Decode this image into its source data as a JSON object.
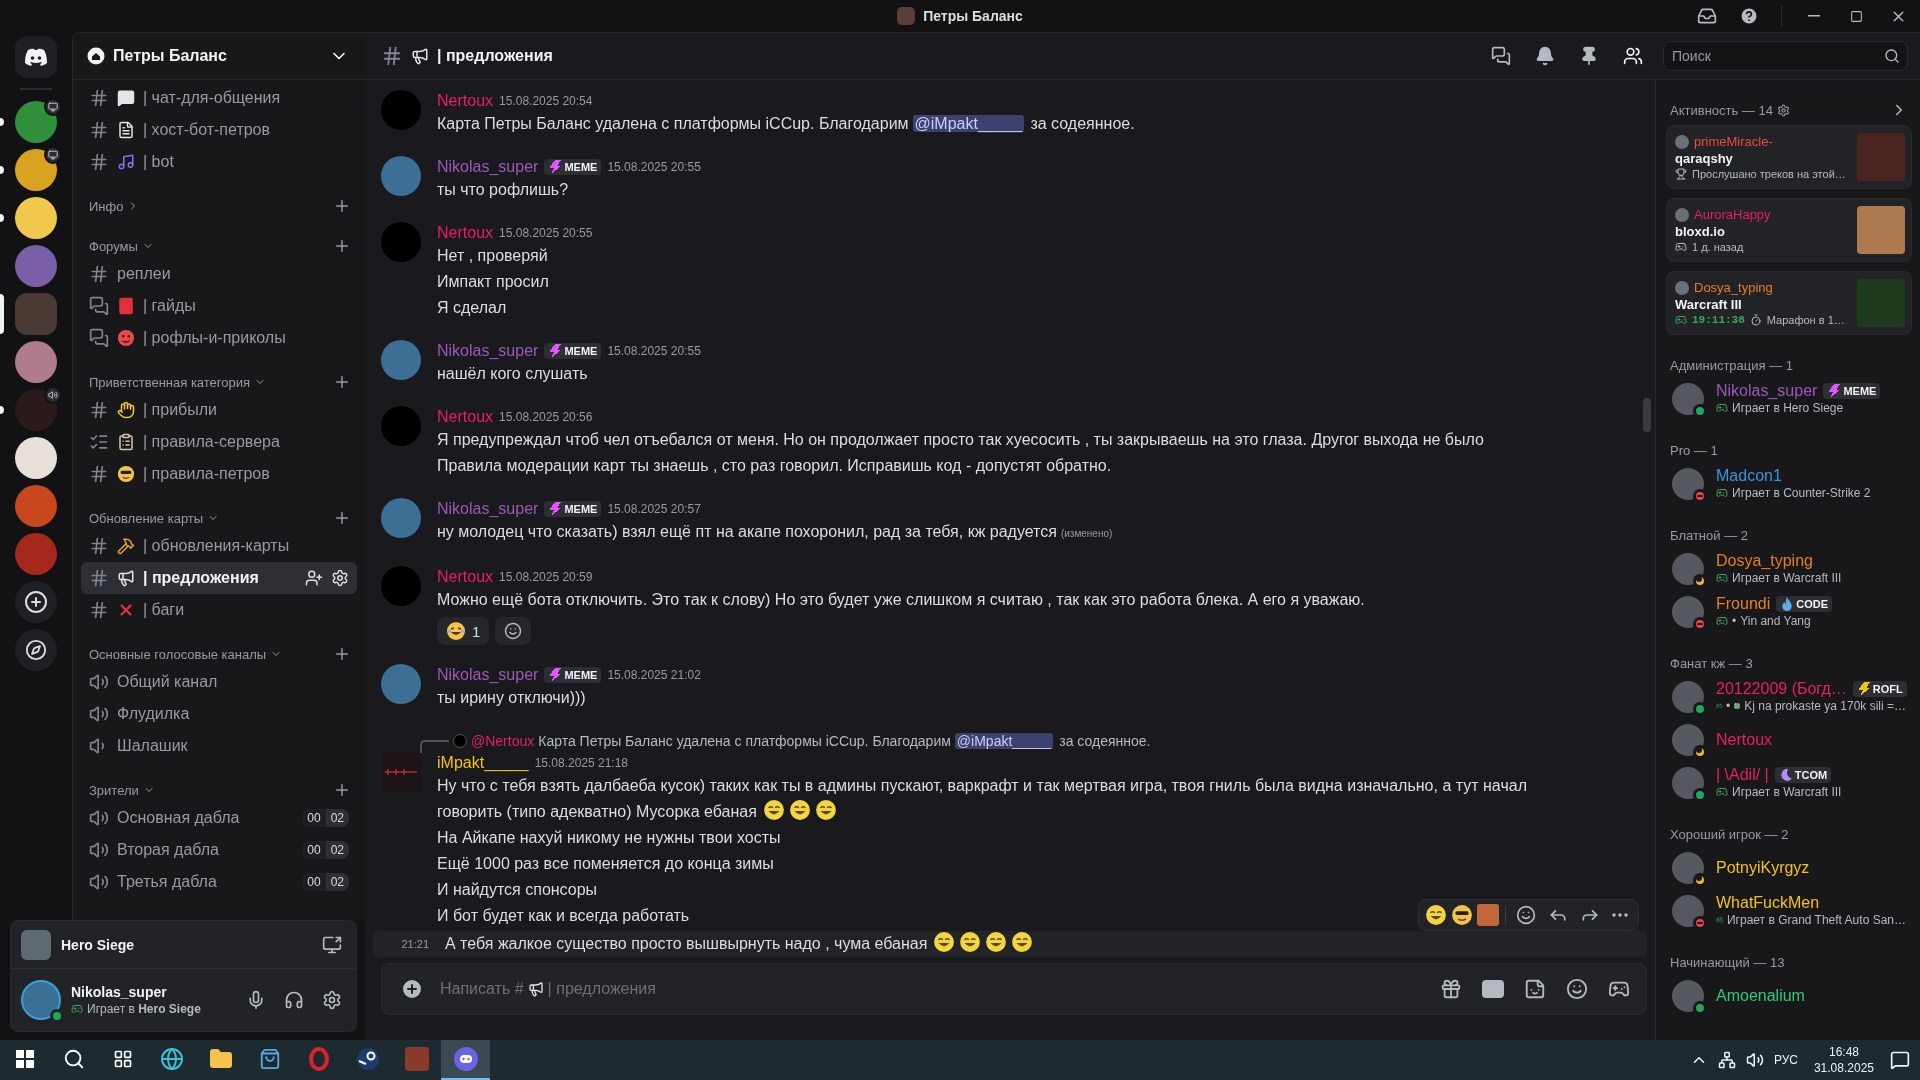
{
  "window": {
    "title": "Петры Баланс"
  },
  "servers": [
    {
      "selected": false,
      "unread": true
    },
    {
      "selected": false,
      "unread": true
    },
    {
      "selected": false,
      "unread": true
    },
    {
      "selected": false,
      "unread": false
    },
    {
      "selected": true,
      "unread": false
    },
    {
      "selected": false,
      "unread": false
    },
    {
      "selected": false,
      "unread": true
    },
    {
      "selected": false,
      "unread": false
    },
    {
      "selected": false,
      "unread": false
    },
    {
      "selected": false,
      "unread": false
    }
  ],
  "sidebar": {
    "server_name": "Петры Баланс",
    "sections": [
      {
        "channels": [
          {
            "kind": "text",
            "name": "| чат-для-общения",
            "selected": false
          },
          {
            "kind": "text",
            "name": "| хост-бот-петров",
            "selected": false
          },
          {
            "kind": "text",
            "name": "| bot",
            "selected": false
          }
        ]
      },
      {
        "title": "Инфо",
        "expanded": false
      },
      {
        "title": "Форумы",
        "expanded": true,
        "channels": [
          {
            "kind": "text",
            "name": "реплеи",
            "selected": false
          },
          {
            "kind": "forum",
            "name": "| гайды",
            "selected": false
          },
          {
            "kind": "forum",
            "name": "| рофлы-и-приколы",
            "selected": false
          }
        ]
      },
      {
        "title": "Приветственная категория",
        "expanded": true,
        "channels": [
          {
            "kind": "text",
            "name": "| прибыли",
            "selected": false
          },
          {
            "kind": "rules",
            "name": "| правила-сервера",
            "selected": false
          },
          {
            "kind": "text",
            "name": "| правила-петров",
            "selected": false
          }
        ]
      },
      {
        "title": "Обновление карты",
        "expanded": true,
        "channels": [
          {
            "kind": "text",
            "name": "| обновления-карты",
            "selected": false
          },
          {
            "kind": "text",
            "name": "| предложения",
            "selected": true
          },
          {
            "kind": "text",
            "name": "| баги",
            "selected": false
          }
        ]
      },
      {
        "title": "Основные голосовые каналы",
        "expanded": true,
        "channels": [
          {
            "kind": "voice",
            "name": "Общий канал",
            "selected": false
          },
          {
            "kind": "voice",
            "name": "Флудилка",
            "selected": false
          },
          {
            "kind": "voice_special",
            "name": "Шалашик",
            "selected": false
          }
        ]
      },
      {
        "title": "Зрители",
        "expanded": true,
        "channels": [
          {
            "kind": "voice",
            "name": "Основная дабла",
            "selected": false,
            "counts": [
              "00",
              "02"
            ]
          },
          {
            "kind": "voice",
            "name": "Вторая дабла",
            "selected": false,
            "counts": [
              "00",
              "02"
            ]
          },
          {
            "kind": "voice",
            "name": "Третья дабла",
            "selected": false,
            "counts": [
              "00",
              "02"
            ]
          }
        ]
      }
    ],
    "activity": {
      "title": "Hero Siege"
    },
    "user": {
      "name": "Nikolas_super",
      "idle": false,
      "dnd": false,
      "activity": "Играет в **Hero Siege**"
    }
  },
  "chat": {
    "channel": "| предложения",
    "search_placeholder": "Поиск",
    "messages": [
      {
        "kind": "message",
        "author": "Nertoux",
        "color": "#e91e63",
        "time": "15.08.2025 20:54",
        "lines": [
          {
            "text": "Карта Петры Баланс удалена с платформы iCCup. Благодарим",
            "mention": "@iMpakt_____",
            "after": "за содеянное."
          }
        ]
      },
      {
        "kind": "message",
        "author": "Nikolas_super",
        "color": "#9b59b6",
        "tag": {
          "text": "MEME",
          "kind": "bolt",
          "color": "#e056fd"
        },
        "time": "15.08.2025 20:55",
        "lines": [
          {
            "text": "ты что рофлишь?"
          }
        ]
      },
      {
        "kind": "message",
        "author": "Nertoux",
        "color": "#e91e63",
        "time": "15.08.2025 20:55",
        "lines": [
          {
            "text": "Нет , проверяй"
          },
          {
            "text": "Импакт просил"
          },
          {
            "text": "Я сделал"
          }
        ]
      },
      {
        "kind": "message",
        "author": "Nikolas_super",
        "color": "#9b59b6",
        "tag": {
          "text": "MEME",
          "kind": "bolt",
          "color": "#e056fd"
        },
        "time": "15.08.2025 20:55",
        "lines": [
          {
            "text": "нашёл кого слушать"
          }
        ]
      },
      {
        "kind": "message",
        "author": "Nertoux",
        "color": "#e91e63",
        "time": "15.08.2025 20:56",
        "lines": [
          {
            "text": "Я предупреждал чтоб чел отъебался от меня. Но он продолжает просто так хуесосить , ты закрываешь на это глаза. Другог выхода не было"
          },
          {
            "text": "Правила модерации карт ты знаешь , сто раз говорил. Исправишь код - допустят обратно."
          }
        ]
      },
      {
        "kind": "message",
        "author": "Nikolas_super",
        "color": "#9b59b6",
        "tag": {
          "text": "MEME",
          "kind": "bolt",
          "color": "#e056fd"
        },
        "time": "15.08.2025 20:57",
        "lines": [
          {
            "text": "ну молодец что сказать) взял ещё пт на акапе похоронил, рад за тебя, кж радуется",
            "edited": "(изменено)"
          }
        ]
      },
      {
        "kind": "message",
        "author": "Nertoux",
        "color": "#e91e63",
        "time": "15.08.2025 20:59",
        "lines": [
          {
            "text": "Можно ещё бота отключить. Это так к слову) Но это будет уже слишком я считаю , так как это работа блека. А его я уважаю."
          }
        ],
        "reactions": [
          {
            "count": "1",
            "selected": false
          }
        ]
      },
      {
        "kind": "message",
        "author": "Nikolas_super",
        "color": "#9b59b6",
        "tag": {
          "text": "MEME",
          "kind": "bolt",
          "color": "#e056fd"
        },
        "time": "15.08.2025 21:02",
        "lines": [
          {
            "text": "ты ирину отключи)))"
          }
        ]
      },
      {
        "kind": "message",
        "author": "iMpakt_____",
        "color": "#f1c40f",
        "time": "15.08.2025 21:18",
        "reply": {
          "author": "@Nertoux",
          "color": "#e91e63",
          "text": "Карта Петры Баланс удалена с платформы iCCup. Благодарим",
          "mention": "@iMpakt_____",
          "after": "за содеянное."
        },
        "lines": [
          {
            "text": "Ну что с тебя  взять далбаеба кусок) таких как ты в админы пускают, варкрафт и так мертвая игра, твоя гниль была видна изначально, а тут начал говорить (типо адекватно) Мусорка ебаная"
          },
          {
            "text": "На Айкапе нахуй никому не нужны твои хосты"
          },
          {
            "text": "Ещё 1000 раз все поменяется до конца зимы"
          },
          {
            "text": "И найдутся спонсоры"
          },
          {
            "text": "И бот будет как и всегда работать"
          }
        ]
      },
      {
        "kind": "continuation",
        "time": "21:21",
        "hovered": true,
        "lines": [
          {
            "text": "А тебя жалкое существо просто вышвырнуть надо , чума ебаная"
          }
        ]
      }
    ],
    "composer": {
      "placeholder": "Написать #",
      "placeholder_channel": "| предложения"
    }
  },
  "members": {
    "activity_header": "Активность — 14",
    "activities": [
      {
        "kind": "trophy",
        "user": "primeMiracle-",
        "color": "#e74c3c",
        "title": "qaraqshy",
        "detail": "Прослушано треков на этой…"
      },
      {
        "kind": "gamepad",
        "user": "AuroraHappy",
        "color": "#e91e63",
        "title": "bloxd.io",
        "detail": "1 д. назад"
      },
      {
        "kind": "timer",
        "user": "Dosya_typing",
        "color": "#e67e22",
        "title": "Warcraft III",
        "elapsed": "19:11:38",
        "detail": "Марафон в 1…"
      }
    ],
    "groups": [
      {
        "title": "Администрация — 1",
        "members": [
          {
            "name": "Nikolas_super",
            "color": "#9b59b6",
            "idle": false,
            "dnd": false,
            "tag": {
              "text": "MEME",
              "kind": "bolt",
              "color": "#e056fd"
            },
            "activity": "Играет в Hero Siege"
          }
        ]
      },
      {
        "title": "Pro — 1",
        "members": [
          {
            "name": "Madcon1",
            "color": "#3498db",
            "idle": false,
            "dnd": true,
            "activity": "Играет в Counter-Strike 2"
          }
        ]
      },
      {
        "title": "Блатной — 2",
        "members": [
          {
            "name": "Dosya_typing",
            "color": "#e67e22",
            "idle": true,
            "dnd": false,
            "activity": "Играет в Warcraft III"
          },
          {
            "name": "Froundi",
            "color": "#e67e22",
            "idle": false,
            "dnd": true,
            "tag": {
              "text": "CODE",
              "kind": "flame",
              "color": "#5dadec"
            },
            "prefix": "•",
            "activity": "Yin and Yang"
          }
        ]
      },
      {
        "title": "Фанат кж — 3",
        "members": [
          {
            "name": "20122009 (Богд…",
            "color": "#e91e63",
            "idle": false,
            "dnd": false,
            "tag": {
              "text": "ROFL",
              "kind": "bolt",
              "color": "#f1c40f"
            },
            "prefix": "•",
            "activity": "Kj na prokaste ya 170k sili =…"
          },
          {
            "name": "Nertoux",
            "color": "#e91e63",
            "idle": true,
            "dnd": false
          },
          {
            "name": "|  \\Adil/  |",
            "color": "#e91e63",
            "idle": false,
            "dnd": false,
            "tag": {
              "text": "TCOM",
              "kind": "moon",
              "color": "#b48cff"
            },
            "activity": "Играет в Warcraft III"
          }
        ]
      },
      {
        "title": "Хороший игрок — 2",
        "members": [
          {
            "name": "PotnyiKyrgyz",
            "color": "#f1c40f",
            "idle": true,
            "dnd": false
          },
          {
            "name": "WhatFuckMen",
            "color": "#f1c40f",
            "idle": false,
            "dnd": true,
            "activity": "Играет в Grand Theft Auto San…"
          }
        ]
      },
      {
        "title": "Начинающий — 13",
        "members": [
          {
            "name": "Amoenalium",
            "color": "#2ecc71",
            "idle": false,
            "dnd": false
          }
        ]
      }
    ]
  },
  "taskbar": {
    "apps": [
      {
        "kind": "start",
        "selected": false
      },
      {
        "kind": "search",
        "selected": false
      },
      {
        "kind": "taskview",
        "selected": false
      },
      {
        "kind": "browser",
        "selected": false
      },
      {
        "kind": "folder",
        "selected": false
      },
      {
        "kind": "store",
        "selected": false
      },
      {
        "kind": "ring",
        "selected": false
      },
      {
        "kind": "steam",
        "selected": false
      },
      {
        "kind": "game",
        "selected": false
      },
      {
        "kind": "chat",
        "selected": true
      }
    ],
    "language": "РУС",
    "time": "16:48",
    "date": "31.08.2025"
  }
}
